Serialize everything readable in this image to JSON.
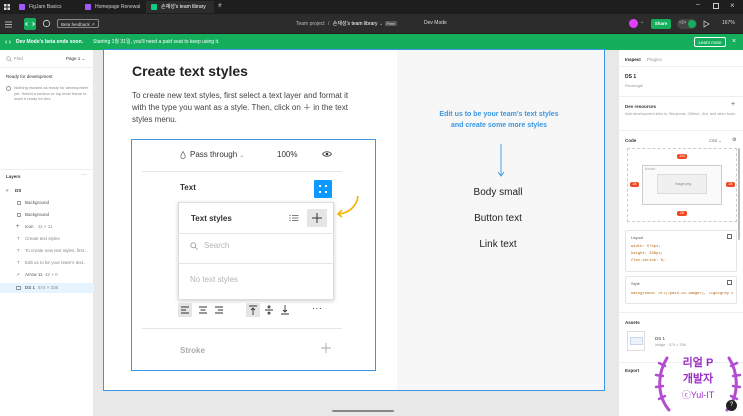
{
  "tabs": [
    {
      "label": "FigJam Basics"
    },
    {
      "label": "Homepage Renewal"
    },
    {
      "label": "손재성's team library"
    }
  ],
  "toolbar": {
    "feedback_label": "Beta feedback ↗",
    "breadcrumb_project": "Team project",
    "breadcrumb_sep": "/",
    "file_name": "손재성's team library",
    "file_badge": "Free",
    "mode_label": "Dev Mode",
    "share_label": "Share",
    "zoom_label": "167%"
  },
  "banner": {
    "title": "Dev Mode's beta ends soon.",
    "text": "Starting 1월 31일, you'll need a paid seat to keep using it.",
    "learn_more": "Learn more"
  },
  "left": {
    "search_placeholder": "Find",
    "page_label": "Page 1",
    "ready_title": "Ready for development",
    "ready_text": "Nothing marked as ready for development yet. Select a section or top-level frame to mark it ready for dev.",
    "layers_title": "Layers",
    "layers": [
      {
        "name": "DS",
        "meta": ""
      },
      {
        "name": "Background",
        "meta": ""
      },
      {
        "name": "Background",
        "meta": ""
      },
      {
        "name": "Icon",
        "meta": "11 × 11"
      },
      {
        "name": "Create text styles",
        "meta": ""
      },
      {
        "name": "To create new text styles, first...",
        "meta": ""
      },
      {
        "name": "Edit us to be your team's text...",
        "meta": ""
      },
      {
        "name": "Arrow 11",
        "meta": "42 × 0"
      },
      {
        "name": "DS 1",
        "meta": "574 × 336"
      }
    ]
  },
  "canvas": {
    "heading": "Create text styles",
    "body_text": "To create new text styles, first select a text layer and format it with the type you want as a style. Then, click on ＋ in the text styles menu.",
    "panel": {
      "pass_through": "Pass through",
      "opacity": "100%",
      "text_label": "Text",
      "text_styles": "Text styles",
      "search_placeholder": "Search",
      "no_styles": "No text styles",
      "stroke_label": "Stroke"
    },
    "blue_note": "Edit us to be your team's text styles and create some more styles",
    "samples": [
      "Body small",
      "Button text",
      "Link text"
    ]
  },
  "right": {
    "tabs": [
      "Inspect",
      "Plugins"
    ],
    "element_name": "DS 1",
    "element_type": "Rectangle",
    "dev_resources_title": "Dev resources",
    "dev_resources_text": "Add development links to Storybook, GitHub, Jira, and other tools",
    "code_title": "Code",
    "code_lang": "CSS",
    "box": {
      "top": "144",
      "left": "28",
      "right": "28",
      "bottom": "28",
      "border": "Border",
      "inner": "image.png"
    },
    "layout_title": "Layout",
    "layout_code": [
      "width: 574px;",
      "height: 336px;",
      "flex-shrink: 0;"
    ],
    "style_title": "Style",
    "style_code": [
      "background: url(<path-to-image>), lightgray 0..."
    ],
    "assets_title": "Assets",
    "asset_name": "DS 1",
    "asset_meta": "image · 574 × 336",
    "export_title": "Export"
  },
  "watermark": {
    "line1": "리얼 P",
    "line2": "개발자",
    "line3": "ⓒYul-IT"
  },
  "colors": {
    "accent": "#0d99ff",
    "dev_green": "#14ae5c",
    "canvas_blue": "#3b97e3",
    "orange_arrow": "#f4b400"
  }
}
